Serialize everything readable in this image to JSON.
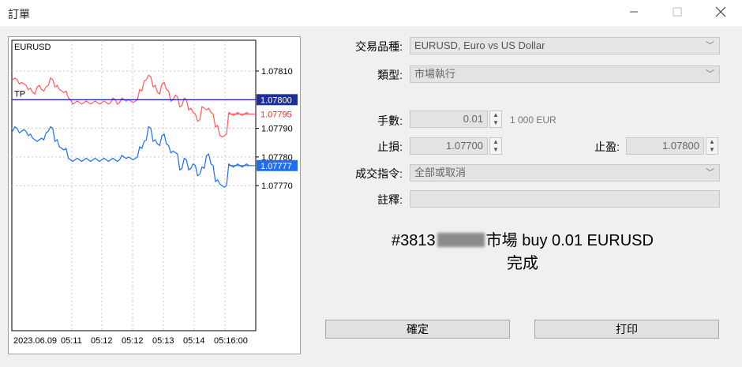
{
  "window": {
    "title": "訂單"
  },
  "chart": {
    "symbol": "EURUSD",
    "tp_label": "TP",
    "price_ticks": [
      "1.07810",
      "1.07790",
      "1.07780",
      "1.07770"
    ],
    "price_tags": {
      "tp": "1.07800",
      "bid": "1.07795",
      "ask": "1.07777"
    },
    "time_ticks": [
      "2023.06.09",
      "05:11",
      "05:12",
      "05:12",
      "05:13",
      "05:14",
      "05:16:00"
    ],
    "colors": {
      "bid_line": "#ff5a5a",
      "ask_line": "#1e6ef0",
      "tp_line": "#0000c8"
    }
  },
  "chart_data": {
    "type": "line",
    "title": "EURUSD",
    "ylim": [
      1.07762,
      1.07816
    ],
    "series": [
      {
        "values": [
          1.07807,
          1.07807,
          1.07806,
          1.07805,
          1.07804,
          1.07802,
          1.07805,
          1.07803,
          1.07805,
          1.07807,
          1.07805,
          1.07803,
          1.07803,
          1.078,
          1.07799,
          1.07799,
          1.07799,
          1.07799,
          1.07799,
          1.07799,
          1.07799,
          1.07799,
          1.07799,
          1.078,
          1.07799,
          1.078,
          1.078,
          1.07799,
          1.078,
          1.07803,
          1.07807,
          1.07808,
          1.07805,
          1.07802,
          1.07806,
          1.07803,
          1.078,
          1.07801,
          1.07798,
          1.078,
          1.07797,
          1.07795,
          1.07793,
          1.07797,
          1.07797,
          1.07795,
          1.07791,
          1.07787,
          1.07788,
          1.07795,
          1.07795,
          1.07795,
          1.07795,
          1.07795
        ]
      },
      {
        "values": [
          1.07789,
          1.0779,
          1.07789,
          1.07789,
          1.07788,
          1.07786,
          1.07786,
          1.07786,
          1.07789,
          1.0779,
          1.07786,
          1.07783,
          1.07783,
          1.07779,
          1.07779,
          1.07779,
          1.07779,
          1.07779,
          1.07779,
          1.07779,
          1.07779,
          1.07779,
          1.07779,
          1.07779,
          1.07779,
          1.0778,
          1.0778,
          1.07779,
          1.0778,
          1.07783,
          1.07786,
          1.0779,
          1.07786,
          1.07784,
          1.07788,
          1.07784,
          1.07782,
          1.07781,
          1.07776,
          1.07779,
          1.07776,
          1.07777,
          1.07774,
          1.07776,
          1.07781,
          1.07777,
          1.07772,
          1.0777,
          1.0777,
          1.07777,
          1.07777,
          1.07777,
          1.07777,
          1.07777
        ]
      }
    ],
    "hlines": {
      "tp": 1.078
    }
  },
  "form": {
    "symbol_label": "交易品種:",
    "symbol_value": "EURUSD, Euro vs US Dollar",
    "type_label": "類型:",
    "type_value": "市場執行",
    "volume_label": "手數:",
    "volume_value": "0.01",
    "volume_unit": "1 000 EUR",
    "sl_label": "止損:",
    "sl_value": "1.07700",
    "tp_label": "止盈:",
    "tp_value": "1.07800",
    "fill_label": "成交指令:",
    "fill_value": "全部或取消",
    "comment_label": "註釋:",
    "comment_value": ""
  },
  "result": {
    "order_prefix": "#3813",
    "order_suffix": "市場 buy 0.01 EURUSD",
    "status": "完成"
  },
  "buttons": {
    "ok": "確定",
    "print": "打印"
  }
}
